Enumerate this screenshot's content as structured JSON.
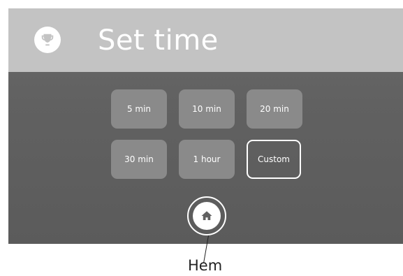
{
  "header": {
    "title": "Set time",
    "icon": "trophy-icon",
    "background": "#c3c3c3"
  },
  "time_options": [
    {
      "label": "5 min",
      "style": "filled"
    },
    {
      "label": "10 min",
      "style": "filled"
    },
    {
      "label": "20 min",
      "style": "filled"
    },
    {
      "label": "30 min",
      "style": "filled"
    },
    {
      "label": "1 hour",
      "style": "filled"
    },
    {
      "label": "Custom",
      "style": "outlined"
    }
  ],
  "home_button": {
    "icon": "home-icon"
  },
  "callout": {
    "label": "Hem"
  },
  "colors": {
    "screen_background": "#616161",
    "button_fill": "#8a8a8a",
    "text": "#ffffff",
    "callout_text": "#222222"
  }
}
